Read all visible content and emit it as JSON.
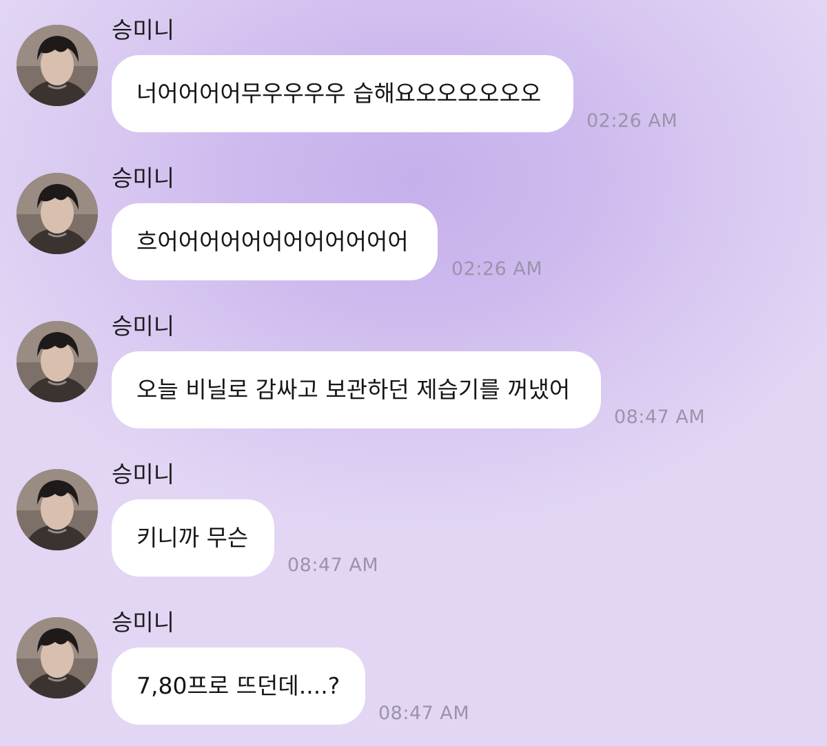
{
  "chat": {
    "messages": [
      {
        "sender": "승미니",
        "text": "너어어어어무우우우우 습해요오오오오오오",
        "time": "02:26 AM"
      },
      {
        "sender": "승미니",
        "text": "흐어어어어어어어어어어어어",
        "time": "02:26 AM"
      },
      {
        "sender": "승미니",
        "text": "오늘 비닐로 감싸고 보관하던 제습기를 꺼냈어",
        "time": "08:47 AM"
      },
      {
        "sender": "승미니",
        "text": "키니까 무슨",
        "time": "08:47 AM"
      },
      {
        "sender": "승미니",
        "text": "7,80프로 뜨던데....?",
        "time": "08:47 AM"
      }
    ]
  },
  "icons": {
    "avatar": "profile-photo-avatar"
  },
  "colors": {
    "background": "#cdbaee",
    "bubble": "#ffffff",
    "timestamp": "#9c93aa",
    "text": "#151515"
  }
}
